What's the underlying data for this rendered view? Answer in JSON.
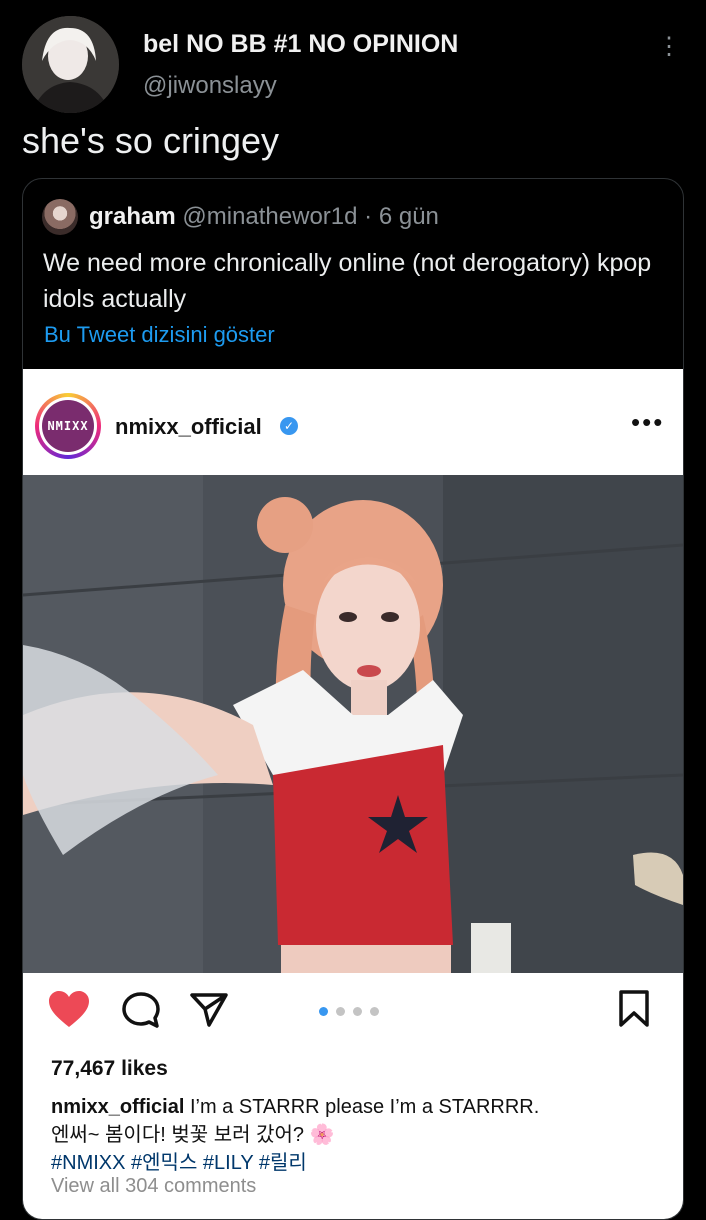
{
  "tweet": {
    "author_name": "bel NO BB #1 NO OPINION",
    "author_handle": "@jiwonslayy",
    "text": "she's so cringey"
  },
  "quote": {
    "author_name": "graham",
    "author_handle": "@minathewor1d",
    "time": "6 gün",
    "text": "We need more chronically online (not derogatory) kpop idols actually",
    "show_thread": "Bu Tweet dizisini göster"
  },
  "instagram": {
    "username": "nmixx_official",
    "logo_text": "NMIXX",
    "likes": "77,467 likes",
    "caption_user": "nmixx_official",
    "caption_line1": "I’m a STARRR please I’m a STARRRR.",
    "caption_line2": "엔써~ 봄이다! 벚꽃 보러 갔어? 🌸",
    "hashtags": "#NMIXX #엔믹스 #LILY #릴리",
    "view_comments": "View all 304 comments",
    "carousel": {
      "count": 4,
      "active_index": 0
    }
  },
  "icons": {
    "like": "heart-icon",
    "comment": "comment-icon",
    "share": "send-icon",
    "save": "bookmark-icon",
    "more": "more-icon"
  },
  "colors": {
    "like_red": "#ed4956",
    "link_blue": "#1d9bf0",
    "carousel_active": "#3897f0"
  }
}
